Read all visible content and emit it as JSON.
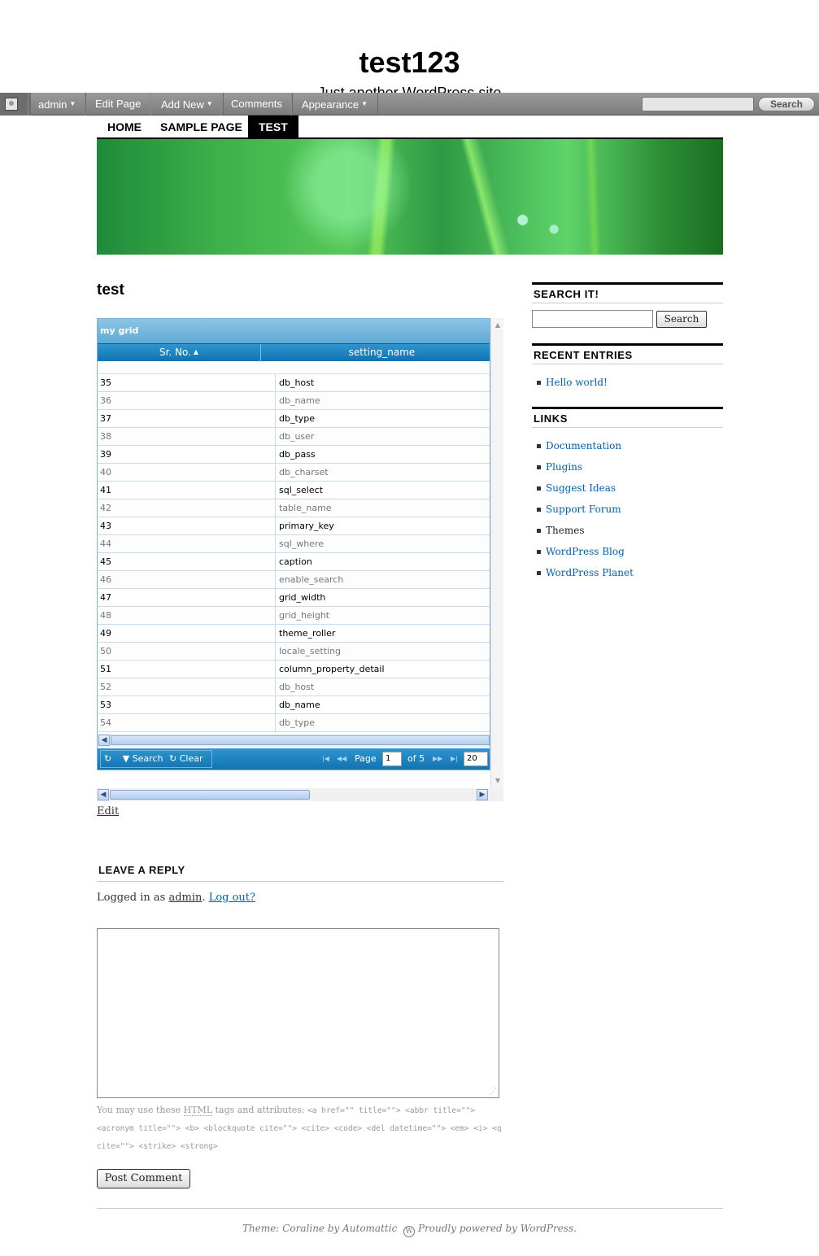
{
  "site": {
    "title": "test123",
    "description": "Just another WordPress site"
  },
  "adminbar": {
    "items": [
      {
        "label": "admin",
        "dropdown": true
      },
      {
        "label": "Edit Page",
        "dropdown": false
      },
      {
        "label": "Add New",
        "dropdown": true
      },
      {
        "label": "Comments",
        "dropdown": false
      },
      {
        "label": "Appearance",
        "dropdown": true
      }
    ],
    "search_placeholder": "",
    "search_button": "Search"
  },
  "nav": {
    "items": [
      {
        "label": "HOME",
        "active": false
      },
      {
        "label": "SAMPLE PAGE",
        "active": false
      },
      {
        "label": "TEST",
        "active": true
      }
    ]
  },
  "page": {
    "title": "test",
    "edit_label": "Edit"
  },
  "grid": {
    "caption": "my grid",
    "columns": [
      "Sr. No.",
      "setting_name"
    ],
    "rows": [
      [
        "35",
        "db_host"
      ],
      [
        "36",
        "db_name"
      ],
      [
        "37",
        "db_type"
      ],
      [
        "38",
        "db_user"
      ],
      [
        "39",
        "db_pass"
      ],
      [
        "40",
        "db_charset"
      ],
      [
        "41",
        "sql_select"
      ],
      [
        "42",
        "table_name"
      ],
      [
        "43",
        "primary_key"
      ],
      [
        "44",
        "sql_where"
      ],
      [
        "45",
        "caption"
      ],
      [
        "46",
        "enable_search"
      ],
      [
        "47",
        "grid_width"
      ],
      [
        "48",
        "grid_height"
      ],
      [
        "49",
        "theme_roller"
      ],
      [
        "50",
        "locale_setting"
      ],
      [
        "51",
        "column_property_detail"
      ],
      [
        "52",
        "db_host"
      ],
      [
        "53",
        "db_name"
      ],
      [
        "54",
        "db_type"
      ]
    ],
    "pager": {
      "search_label": "Search",
      "clear_label": "Clear",
      "page_label": "Page",
      "page_value": "1",
      "of_label": "of 5",
      "rows_per_page": "20"
    }
  },
  "reply": {
    "title": "LEAVE A REPLY",
    "logged_in_prefix": "Logged in as",
    "user": "admin",
    "logout": "Log out?",
    "allowed_prefix": "You may use these",
    "allowed_abbr": "HTML",
    "allowed_mid": "tags and attributes:",
    "allowed_code": "<a href=\"\" title=\"\"> <abbr title=\"\"> <acronym title=\"\"> <b> <blockquote cite=\"\"> <cite> <code> <del datetime=\"\"> <em> <i> <q cite=\"\"> <strike> <strong>",
    "submit": "Post Comment"
  },
  "sidebar": {
    "search_title": "SEARCH IT!",
    "search_button": "Search",
    "recent_title": "RECENT ENTRIES",
    "recent": [
      "Hello world!"
    ],
    "links_title": "LINKS",
    "links": [
      {
        "label": "Documentation",
        "link": true
      },
      {
        "label": "Plugins",
        "link": true
      },
      {
        "label": "Suggest Ideas",
        "link": true
      },
      {
        "label": "Support Forum",
        "link": true
      },
      {
        "label": "Themes",
        "link": false
      },
      {
        "label": "WordPress Blog",
        "link": true
      },
      {
        "label": "WordPress Planet",
        "link": true
      }
    ]
  },
  "footer": {
    "theme": "Theme: Coraline by Automattic",
    "powered": "Proudly powered by WordPress."
  }
}
